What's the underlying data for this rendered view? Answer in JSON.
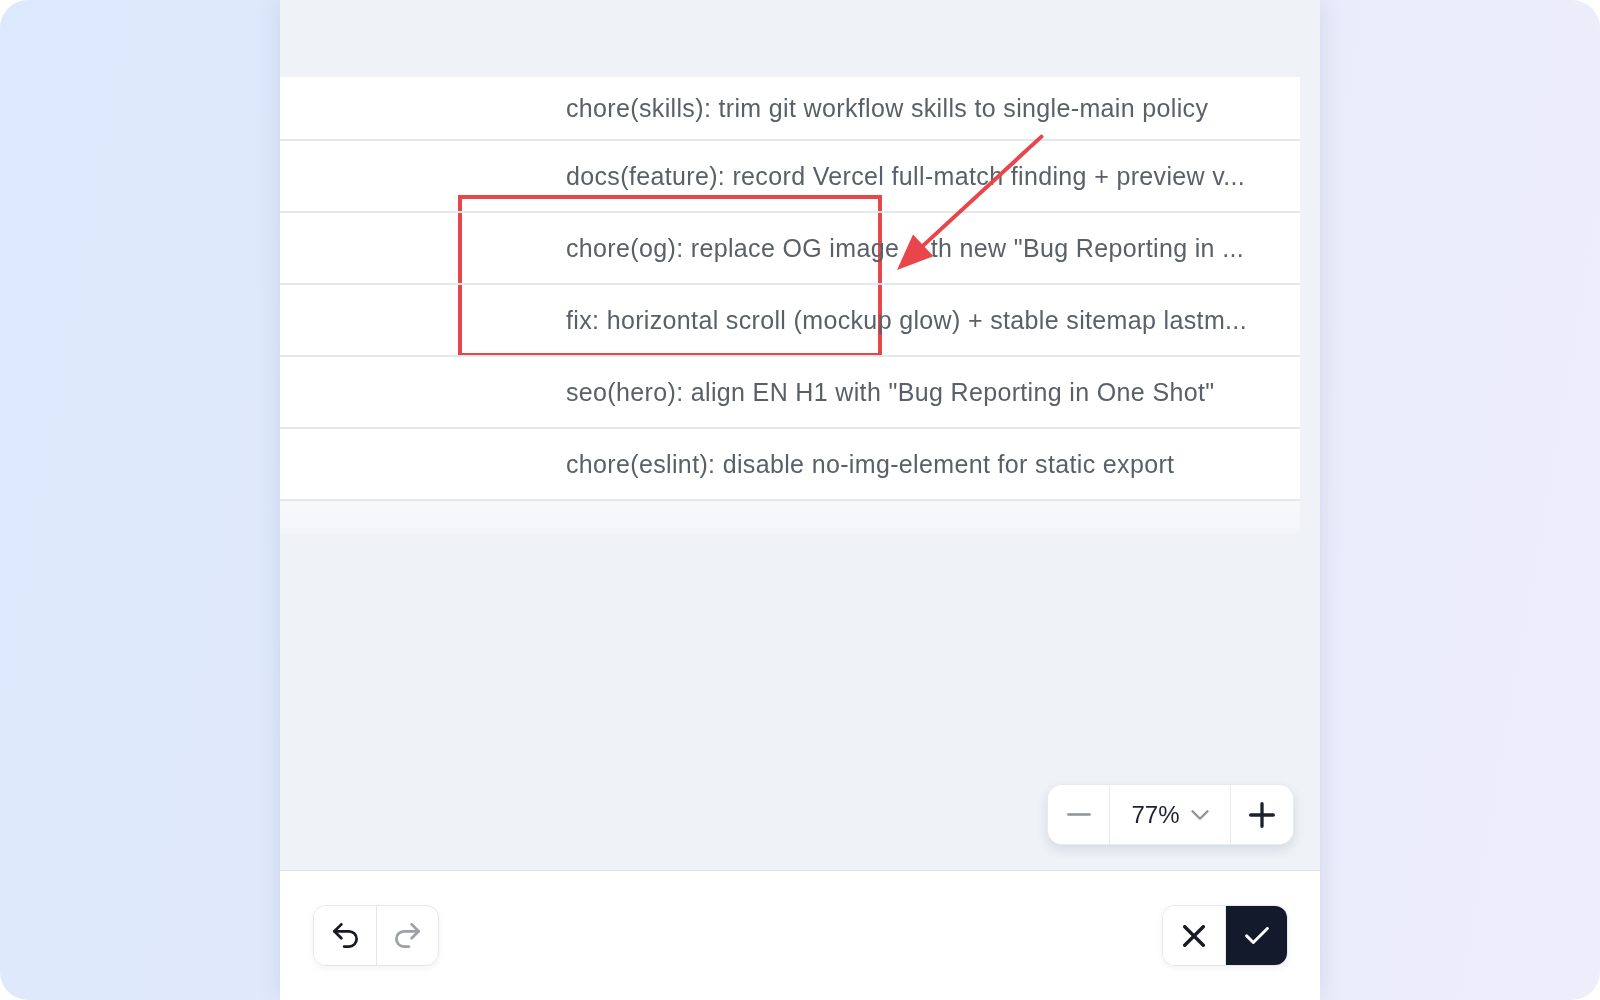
{
  "screenshot": {
    "rows": [
      {
        "text": "chore(skills): trim git workflow skills to single-main policy"
      },
      {
        "text": "docs(feature): record Vercel full-match finding + preview v..."
      },
      {
        "text": "chore(og): replace OG image",
        "text_after_arrow": "th new \"Bug Reporting in ..."
      },
      {
        "text": "fix: horizontal scroll (mockup glow) + stable sitemap lastm..."
      },
      {
        "text": "seo(hero): align EN H1 with \"Bug Reporting in One Shot\""
      },
      {
        "text": "chore(eslint): disable no-img-element for static export"
      }
    ]
  },
  "annotations": [
    {
      "kind": "rectangle"
    },
    {
      "kind": "arrow"
    }
  ],
  "zoom": {
    "value": "77%"
  },
  "history_buttons": [
    {
      "kind": "undo",
      "disabled": false
    },
    {
      "kind": "redo",
      "disabled": true
    }
  ],
  "action_buttons": [
    {
      "kind": "cancel"
    },
    {
      "kind": "confirm"
    }
  ]
}
